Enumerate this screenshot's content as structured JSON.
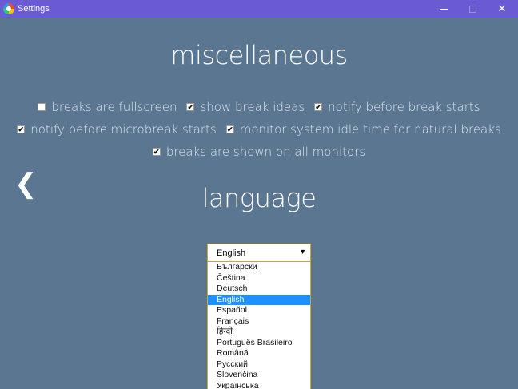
{
  "window": {
    "title": "Settings",
    "minimize": "—",
    "maximize": "□",
    "close": "✕"
  },
  "misc": {
    "heading": "miscellaneous",
    "options": [
      {
        "label": "breaks are fullscreen",
        "checked": false
      },
      {
        "label": "show break ideas",
        "checked": true
      },
      {
        "label": "notify before break starts",
        "checked": true
      },
      {
        "label": "notify before microbreak starts",
        "checked": true
      },
      {
        "label": "monitor system idle time for natural breaks",
        "checked": true
      },
      {
        "label": "breaks are shown on all monitors",
        "checked": true
      }
    ]
  },
  "nav": {
    "back": "❮"
  },
  "language": {
    "heading": "language",
    "selected": "English",
    "arrow": "▼",
    "options": [
      "Български",
      "Čeština",
      "Deutsch",
      "English",
      "Español",
      "Français",
      "हिन्दी",
      "Português Brasileiro",
      "Română",
      "Русский",
      "Slovenčina",
      "Українська"
    ],
    "selected_index": 3
  },
  "colors": {
    "background": "#5a7691",
    "titlebar": "#6a5ad4",
    "highlight": "#1e90ff",
    "select_border": "#d4a23c"
  }
}
